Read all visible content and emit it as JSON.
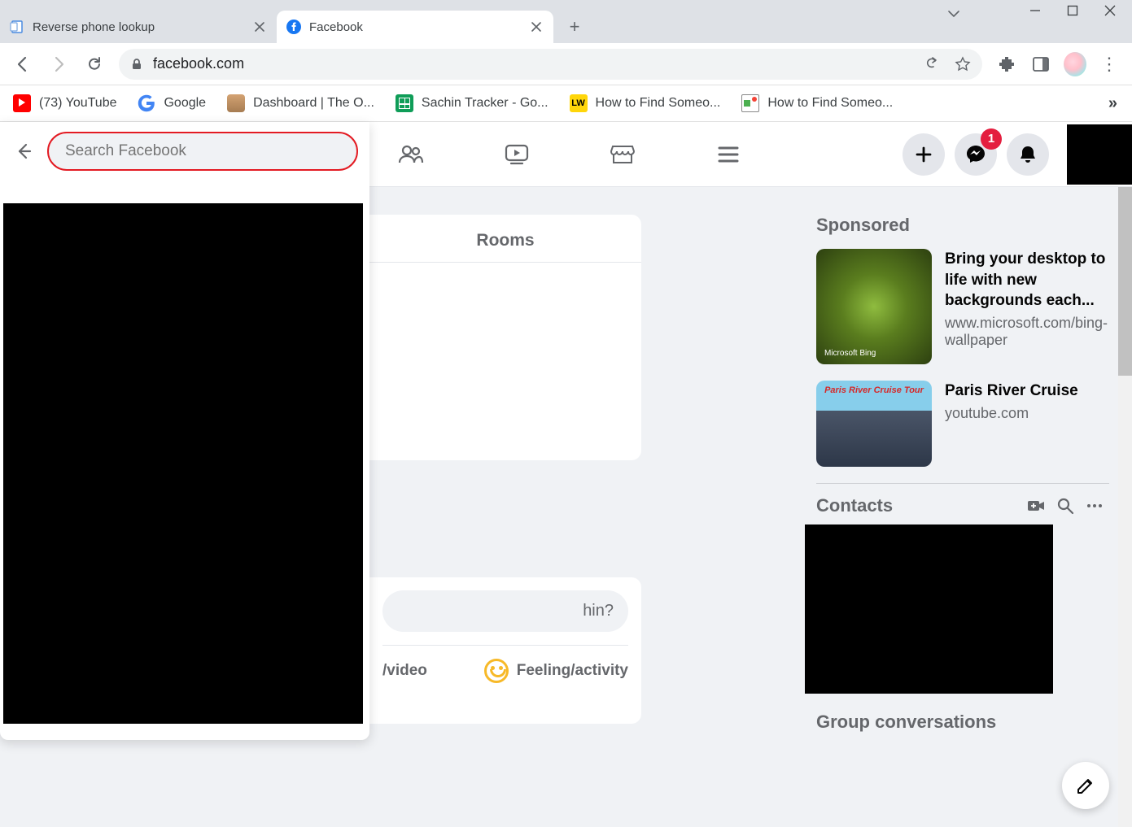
{
  "browser": {
    "tabs": [
      {
        "title": "Reverse phone lookup",
        "active": false
      },
      {
        "title": "Facebook",
        "active": true
      }
    ],
    "url": "facebook.com"
  },
  "bookmarks": [
    {
      "label": "(73) YouTube",
      "icon": "youtube"
    },
    {
      "label": "Google",
      "icon": "google"
    },
    {
      "label": "Dashboard | The O...",
      "icon": "odin"
    },
    {
      "label": "Sachin Tracker - Go...",
      "icon": "sheets"
    },
    {
      "label": "How to Find Someo...",
      "icon": "lw"
    },
    {
      "label": "How to Find Someo...",
      "icon": "pic"
    }
  ],
  "fb": {
    "search_placeholder": "Search Facebook",
    "rooms_tab": "Rooms",
    "composer_hint": "hin?",
    "composer_video": "/video",
    "composer_feeling": "Feeling/activity",
    "messenger_badge": "1",
    "sponsored_label": "Sponsored",
    "sponsored": [
      {
        "title": "Bring your desktop to life with new backgrounds each...",
        "url": "www.microsoft.com/bing-wallpaper"
      },
      {
        "title": "Paris River Cruise",
        "url": "youtube.com"
      }
    ],
    "contacts_label": "Contacts",
    "group_conv_label": "Group conversations"
  }
}
